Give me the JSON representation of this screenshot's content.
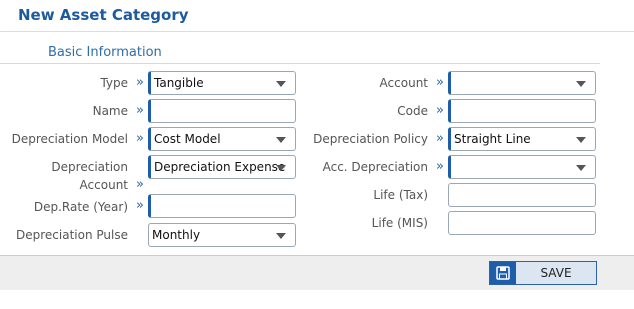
{
  "page": {
    "title": "New Asset Category"
  },
  "section": {
    "title": "Basic Information"
  },
  "left": {
    "type_label": "Type",
    "type_value": "Tangible",
    "name_label": "Name",
    "name_value": "",
    "dep_model_label": "Depreciation Model",
    "dep_model_value": "Cost Model",
    "dep_account_label_1": "Depreciation",
    "dep_account_label_2": "Account",
    "dep_account_value": "Depreciation Expense",
    "dep_rate_label": "Dep.Rate (Year)",
    "dep_rate_value": "",
    "dep_pulse_label": "Depreciation Pulse",
    "dep_pulse_value": "Monthly"
  },
  "right": {
    "account_label": "Account",
    "account_value": "",
    "code_label": "Code",
    "code_value": "",
    "dep_policy_label": "Depreciation Policy",
    "dep_policy_value": "Straight Line",
    "acc_dep_label": "Acc. Depreciation",
    "acc_dep_value": "",
    "life_tax_label": "Life (Tax)",
    "life_tax_value": "",
    "life_mis_label": "Life (MIS)",
    "life_mis_value": ""
  },
  "footer": {
    "save_label": "SAVE"
  },
  "colors": {
    "accent": "#1e5ea8",
    "title": "#1d5a9e",
    "footer_bg": "#eeeeee"
  },
  "icons": {
    "link": "double-chevron-right-icon",
    "dropdown": "caret-down-icon",
    "save": "floppy-disk-icon"
  }
}
